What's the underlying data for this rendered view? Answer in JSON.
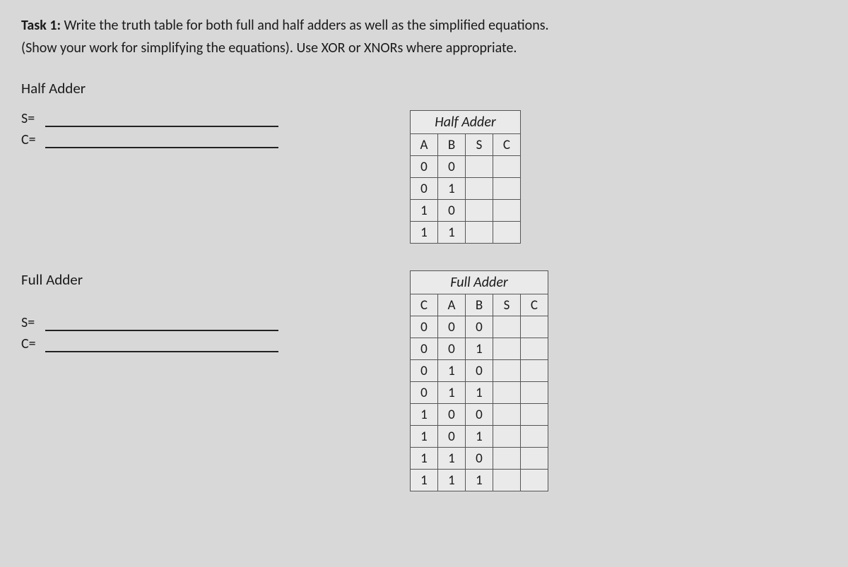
{
  "task": {
    "label": "Task 1:",
    "text1": " Write the truth table for both full and half adders as well as the simplified equations.",
    "text2": "(Show your work for simplifying the equations).  Use XOR or XNORs where appropriate."
  },
  "half": {
    "heading": "Half Adder",
    "eq_s_label": "S=",
    "eq_c_label": "C=",
    "table": {
      "caption": "Half Adder",
      "headers": [
        "A",
        "B",
        "S",
        "C"
      ],
      "rows": [
        [
          "0",
          "0",
          "",
          ""
        ],
        [
          "0",
          "1",
          "",
          ""
        ],
        [
          "1",
          "0",
          "",
          ""
        ],
        [
          "1",
          "1",
          "",
          ""
        ]
      ]
    }
  },
  "full": {
    "heading": "Full Adder",
    "eq_s_label": "S=",
    "eq_c_label": "C=",
    "table": {
      "caption": "Full Adder",
      "headers": [
        "C",
        "A",
        "B",
        "S",
        "C"
      ],
      "rows": [
        [
          "0",
          "0",
          "0",
          "",
          ""
        ],
        [
          "0",
          "0",
          "1",
          "",
          ""
        ],
        [
          "0",
          "1",
          "0",
          "",
          ""
        ],
        [
          "0",
          "1",
          "1",
          "",
          ""
        ],
        [
          "1",
          "0",
          "0",
          "",
          ""
        ],
        [
          "1",
          "0",
          "1",
          "",
          ""
        ],
        [
          "1",
          "1",
          "0",
          "",
          ""
        ],
        [
          "1",
          "1",
          "1",
          "",
          ""
        ]
      ]
    }
  }
}
